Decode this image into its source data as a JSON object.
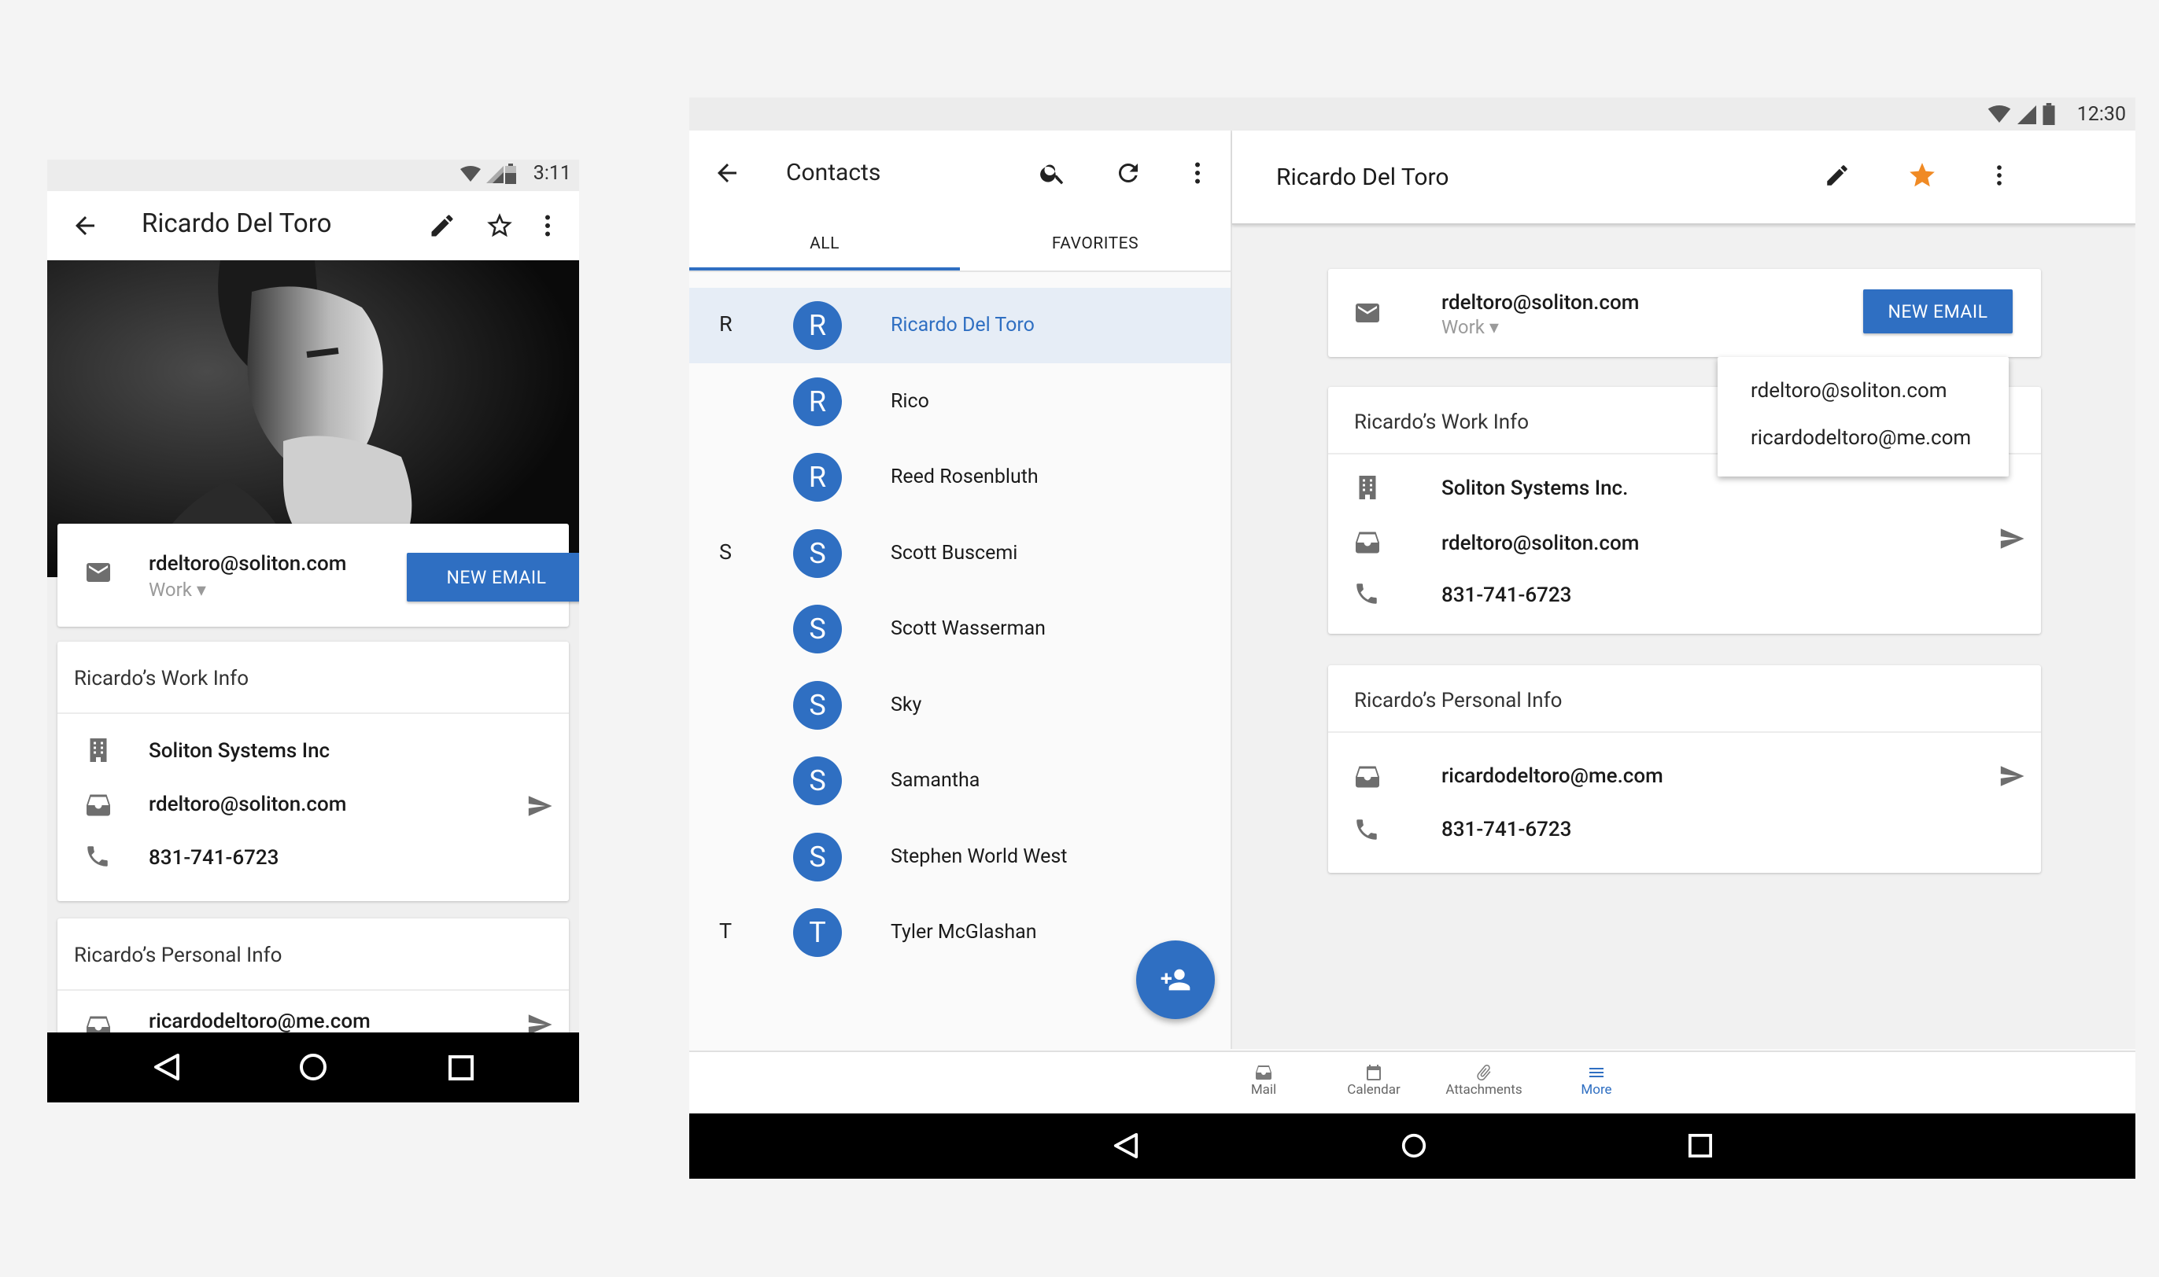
{
  "phone": {
    "status": {
      "time": "3:11"
    },
    "toolbar": {
      "title": "Ricardo Del Toro",
      "icons": [
        "back-arrow-icon",
        "edit-pencil-icon",
        "star-outline-icon",
        "more-vert-icon"
      ]
    },
    "email_card": {
      "email": "rdeltoro@soliton.com",
      "type": "Work ▾",
      "button": "NEW EMAIL"
    },
    "work_info": {
      "title": "Ricardo’s Work Info",
      "company": "Soliton Systems Inc",
      "email": "rdeltoro@soliton.com",
      "phone": "831-741-6723"
    },
    "personal_info": {
      "title": "Ricardo’s Personal Info",
      "email": "ricardodeltoro@me.com"
    }
  },
  "tablet": {
    "status": {
      "time": "12:30"
    },
    "list": {
      "title": "Contacts",
      "tabs": [
        "ALL",
        "FAVORITES"
      ],
      "active_tab": "ALL",
      "contacts": [
        {
          "letter": "R",
          "initial": "R",
          "name": "Ricardo Del Toro",
          "selected": true
        },
        {
          "letter": "",
          "initial": "R",
          "name": "Rico"
        },
        {
          "letter": "",
          "initial": "R",
          "name": "Reed Rosenbluth"
        },
        {
          "letter": "S",
          "initial": "S",
          "name": "Scott Buscemi"
        },
        {
          "letter": "",
          "initial": "S",
          "name": "Scott Wasserman"
        },
        {
          "letter": "",
          "initial": "S",
          "name": "Sky"
        },
        {
          "letter": "",
          "initial": "S",
          "name": "Samantha"
        },
        {
          "letter": "",
          "initial": "S",
          "name": "Stephen World West"
        },
        {
          "letter": "T",
          "initial": "T",
          "name": "Tyler McGlashan"
        }
      ]
    },
    "detail": {
      "title": "Ricardo Del Toro",
      "email_card": {
        "email": "rdeltoro@soliton.com",
        "type": "Work ▾",
        "button": "NEW EMAIL"
      },
      "dropdown": [
        "rdeltoro@soliton.com",
        "ricardodeltoro@me.com"
      ],
      "work_info": {
        "title": "Ricardo’s Work Info",
        "company": "Soliton Systems Inc.",
        "email": "rdeltoro@soliton.com",
        "phone": "831-741-6723"
      },
      "personal_info": {
        "title": "Ricardo’s Personal Info",
        "email": "ricardodeltoro@me.com",
        "phone": "831-741-6723"
      }
    },
    "bottom_bar": [
      {
        "label": "Mail",
        "icon": "mail-tray-icon"
      },
      {
        "label": "Calendar",
        "icon": "calendar-icon"
      },
      {
        "label": "Attachments",
        "icon": "paperclip-icon"
      },
      {
        "label": "More",
        "icon": "menu-icon",
        "active": true
      }
    ]
  },
  "colors": {
    "accent": "#2f6fc2",
    "star_active": "#f08a24",
    "selected_row": "#e6edf6"
  }
}
